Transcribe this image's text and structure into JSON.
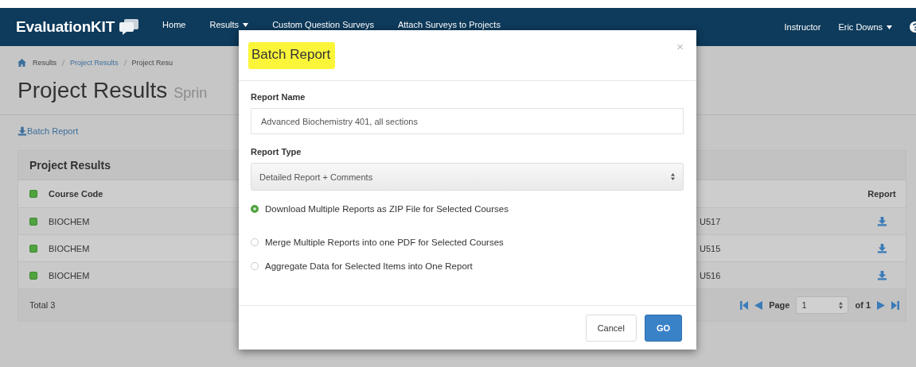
{
  "navbar": {
    "brand": "EvaluationKIT",
    "items": [
      {
        "label": "Home",
        "dropdown": false
      },
      {
        "label": "Results",
        "dropdown": true
      },
      {
        "label": "Custom Question Surveys",
        "dropdown": false
      },
      {
        "label": "Attach Surveys to Projects",
        "dropdown": false
      }
    ],
    "role": "Instructor",
    "user": {
      "label": "Eric Downs",
      "dropdown": true
    }
  },
  "breadcrumb": [
    {
      "label": "Results",
      "link": false
    },
    {
      "label": "Project Results",
      "link": true
    },
    {
      "label": "Project Resu",
      "link": false
    }
  ],
  "page_title": "Project Results",
  "page_subtitle": "Sprin",
  "batch_report_link": "Batch Report",
  "panel": {
    "title": "Project Results",
    "columns": [
      {
        "label": "Course Code",
        "checked": true
      },
      {
        "label": "Report"
      }
    ],
    "rows": [
      {
        "checked": true,
        "course_code": "BIOCHEM",
        "column_2": "U517"
      },
      {
        "checked": true,
        "course_code": "BIOCHEM",
        "column_2": "U515"
      },
      {
        "checked": true,
        "course_code": "BIOCHEM",
        "column_2": "U516"
      }
    ],
    "total": "Total 3",
    "pager": {
      "label": "Page",
      "page": "1",
      "of": "of 1"
    }
  },
  "dialog": {
    "title": "Batch Report",
    "title_highlighted": true,
    "close": "×",
    "report_name_label": "Report Name",
    "report_name_value": "Advanced Biochemistry 401, all sections",
    "report_type_label": "Report Type",
    "report_type_value": "Detailed Report + Comments",
    "options": [
      {
        "label": "Download Multiple Reports as ZIP File for Selected Courses",
        "selected": true
      },
      {
        "label": "Merge Multiple Reports into one PDF for Selected Courses",
        "selected": false
      },
      {
        "label": "Aggregate Data for Selected Items into One Report",
        "selected": false
      }
    ],
    "buttons": [
      {
        "label": "Cancel",
        "kind": "default"
      },
      {
        "label": "GO",
        "kind": "primary"
      }
    ]
  }
}
